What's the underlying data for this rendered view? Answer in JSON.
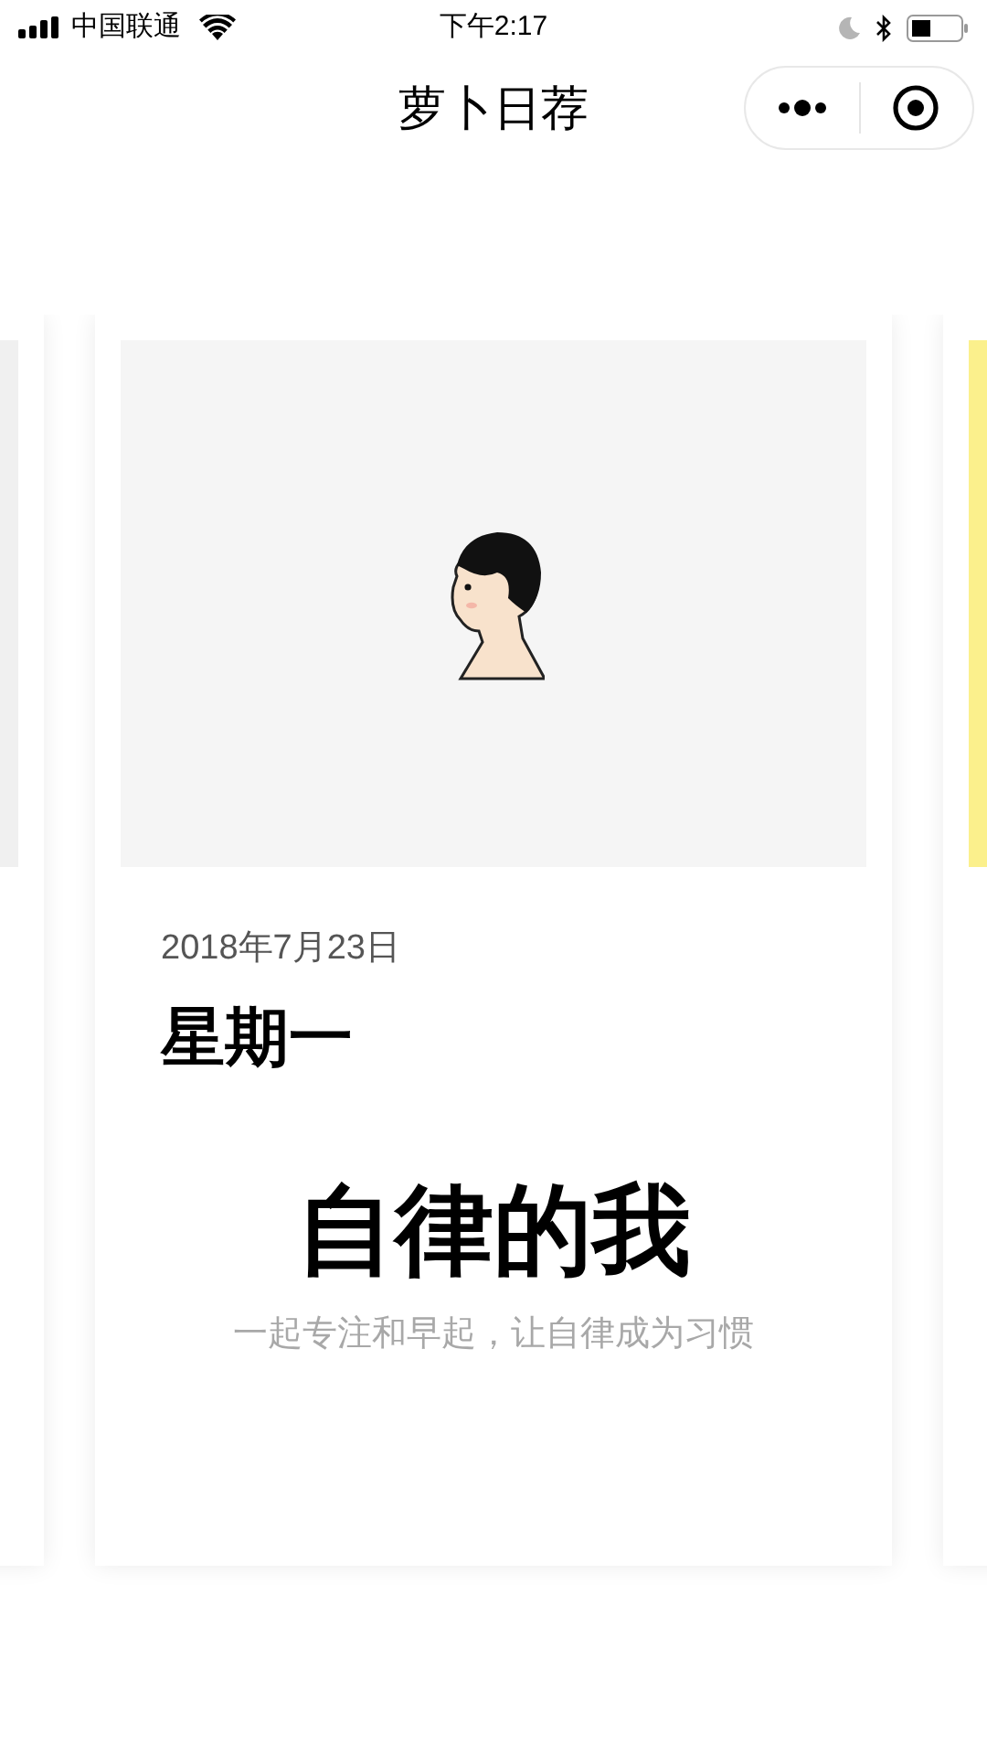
{
  "status_bar": {
    "carrier": "中国联通",
    "time": "下午2:17"
  },
  "nav_bar": {
    "title": "萝卜日荐"
  },
  "cards": [
    {
      "kind": "side",
      "color": "#f0f0f0"
    },
    {
      "kind": "main",
      "color": "#f5f5f5",
      "date": "2018年7月23日",
      "weekday": "星期一",
      "headline": "自律的我",
      "subtitle": "一起专注和早起，让自律成为习惯"
    },
    {
      "kind": "side",
      "color": "#fbf08c"
    }
  ]
}
